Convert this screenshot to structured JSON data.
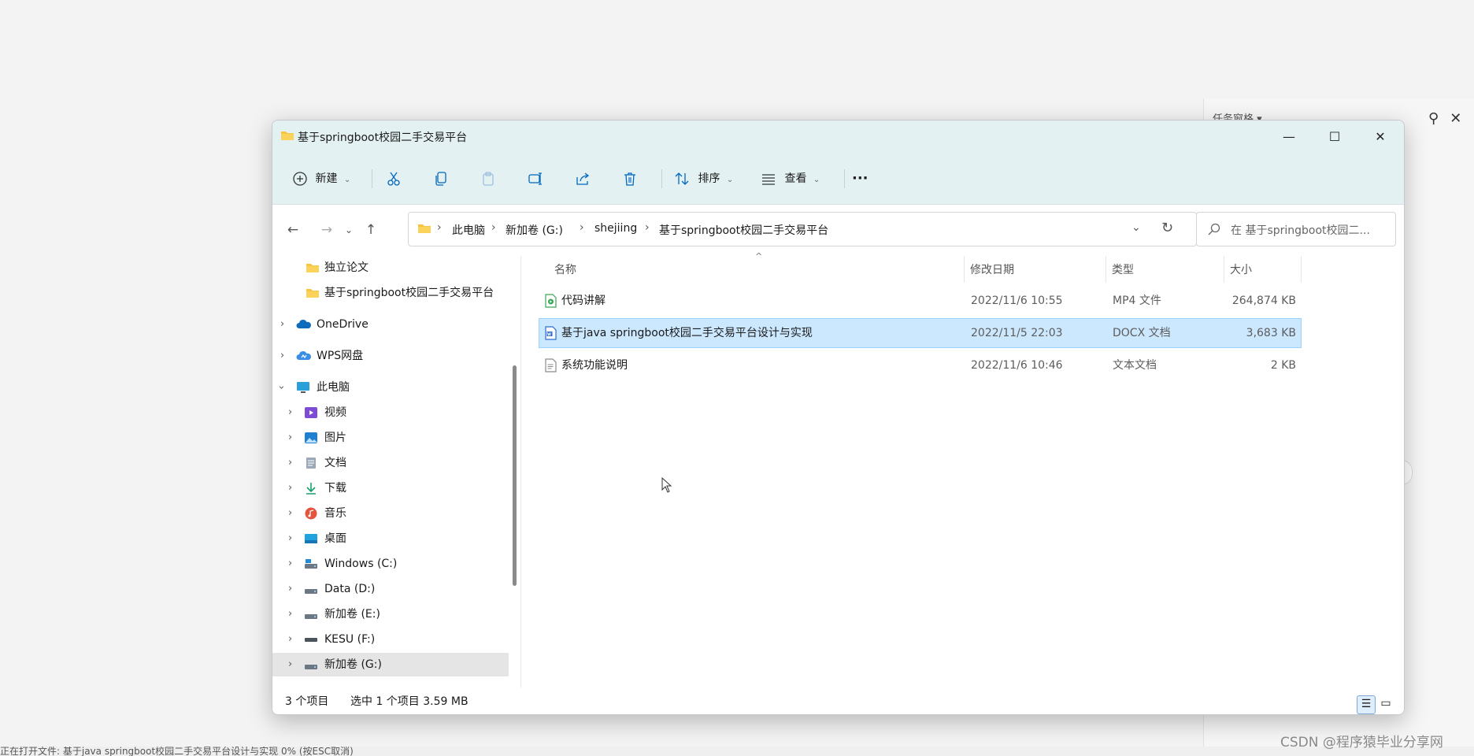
{
  "background": {
    "task_pane_label": "任务窗格 ▾",
    "status_text": "正在打开文件: 基于java springboot校园二手交易平台设计与实现    0%    (按ESC取消)",
    "watermark": "CSDN @程序猿毕业分享网"
  },
  "window": {
    "title": "基于springboot校园二手交易平台",
    "controls": {
      "minimize": "—",
      "maximize": "☐",
      "close": "✕"
    }
  },
  "toolbar": {
    "new_label": "新建",
    "sort_label": "排序",
    "view_label": "查看",
    "more_label": "···"
  },
  "address": {
    "breadcrumbs": [
      "此电脑",
      "新加卷 (G:)",
      "shejiing",
      "基于springboot校园二手交易平台"
    ],
    "search_placeholder": "在 基于springboot校园二..."
  },
  "nav": {
    "items": [
      {
        "label": "独立论文",
        "icon": "folder-icon"
      },
      {
        "label": "基于springboot校园二手交易平台",
        "icon": "folder-icon"
      },
      {
        "label": "OneDrive",
        "icon": "onedrive-icon"
      },
      {
        "label": "WPS网盘",
        "icon": "wps-cloud-icon"
      },
      {
        "label": "此电脑",
        "icon": "computer-icon"
      },
      {
        "label": "视频",
        "icon": "video-icon"
      },
      {
        "label": "图片",
        "icon": "pictures-icon"
      },
      {
        "label": "文档",
        "icon": "documents-icon"
      },
      {
        "label": "下载",
        "icon": "download-icon"
      },
      {
        "label": "音乐",
        "icon": "music-icon"
      },
      {
        "label": "桌面",
        "icon": "desktop-icon"
      },
      {
        "label": "Windows (C:)",
        "icon": "drive-icon"
      },
      {
        "label": "Data (D:)",
        "icon": "drive-icon"
      },
      {
        "label": "新加卷 (E:)",
        "icon": "drive-icon"
      },
      {
        "label": "KESU  (F:)",
        "icon": "usb-drive-icon"
      },
      {
        "label": "新加卷 (G:)",
        "icon": "drive-icon"
      }
    ]
  },
  "columns": {
    "name": "名称",
    "date": "修改日期",
    "type": "类型",
    "size": "大小"
  },
  "files": [
    {
      "name": "代码讲解",
      "date": "2022/11/6 10:55",
      "type": "MP4 文件",
      "size": "264,874 KB",
      "icon": "video-file-icon",
      "selected": false
    },
    {
      "name": "基于java springboot校园二手交易平台设计与实现",
      "date": "2022/11/5 22:03",
      "type": "DOCX 文档",
      "size": "3,683 KB",
      "icon": "word-file-icon",
      "selected": true
    },
    {
      "name": "系统功能说明",
      "date": "2022/11/6 10:46",
      "type": "文本文档",
      "size": "2 KB",
      "icon": "text-file-icon",
      "selected": false
    }
  ],
  "status": {
    "item_count": "3 个项目",
    "selection": "选中 1 个项目  3.59 MB"
  },
  "colors": {
    "titlebar": "#e4f1f2",
    "selection": "#cce8ff",
    "selection_border": "#99d1ff",
    "accent": "#0067c0"
  }
}
